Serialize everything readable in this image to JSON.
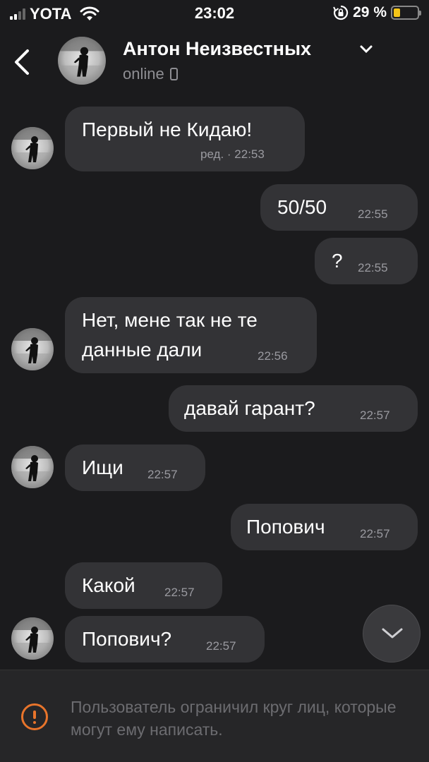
{
  "status_bar": {
    "carrier": "YOTA",
    "time": "23:02",
    "battery": "29 %",
    "battery_level": 0.29
  },
  "header": {
    "name": "Антон Неизвестных",
    "status": "online"
  },
  "messages": [
    {
      "dir": "in",
      "text": "Первый не Кидаю!",
      "time": "ред. · 22:53"
    },
    {
      "dir": "out",
      "text": "50/50",
      "time": "22:55"
    },
    {
      "dir": "out",
      "text": "?",
      "time": "22:55"
    },
    {
      "dir": "in",
      "text_line1": "Нет, мене так не те",
      "text_line2": "данные дали",
      "time": "22:56"
    },
    {
      "dir": "out",
      "text": "давай гарант?",
      "time": "22:57"
    },
    {
      "dir": "in",
      "text": "Ищи",
      "time": "22:57"
    },
    {
      "dir": "out",
      "text": "Попович",
      "time": "22:57"
    },
    {
      "dir": "in",
      "text": "Какой",
      "time": "22:57"
    },
    {
      "dir": "in",
      "text": "Попович?",
      "time": "22:57"
    }
  ],
  "footer": {
    "notice": "Пользователь ограничил круг лиц, которые могут ему написать."
  }
}
